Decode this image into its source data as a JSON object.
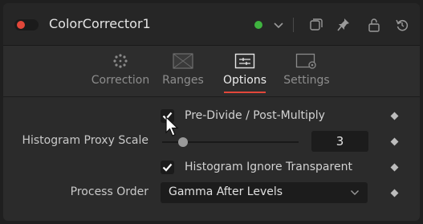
{
  "header": {
    "title": "ColorCorrector1",
    "icons": [
      "enable-toggle",
      "status-dot",
      "chevron-down-icon",
      "versions-icon",
      "pin-icon",
      "lock-icon",
      "reset-icon"
    ],
    "accent": "#e2473a",
    "status_color": "#3fb33f"
  },
  "tabs": [
    {
      "label": "Correction",
      "icon": "color-wheel-icon",
      "active": false
    },
    {
      "label": "Ranges",
      "icon": "ranges-icon",
      "active": false
    },
    {
      "label": "Options",
      "icon": "options-icon",
      "active": true
    },
    {
      "label": "Settings",
      "icon": "settings-icon",
      "active": false
    }
  ],
  "options": {
    "predivide": {
      "label": "Pre-Divide / Post-Multiply",
      "checked": true
    },
    "proxy_scale": {
      "label": "Histogram Proxy Scale",
      "value": "3"
    },
    "ignore_transparent": {
      "label": "Histogram Ignore Transparent",
      "checked": true
    },
    "process_order": {
      "label": "Process Order",
      "value": "Gamma After Levels"
    }
  }
}
